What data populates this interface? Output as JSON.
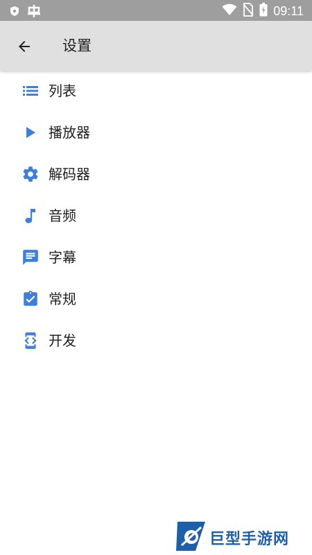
{
  "status_bar": {
    "time": "09:11",
    "icons": [
      "shield-icon",
      "bug-icon",
      "wifi-icon",
      "no-sim-icon",
      "battery-charging-icon"
    ]
  },
  "app_bar": {
    "back_icon": "arrow-back-icon",
    "title": "设置"
  },
  "menu": {
    "items": [
      {
        "label": "列表",
        "icon": "list-icon"
      },
      {
        "label": "播放器",
        "icon": "play-icon"
      },
      {
        "label": "解码器",
        "icon": "gear-icon"
      },
      {
        "label": "音频",
        "icon": "music-note-icon"
      },
      {
        "label": "字幕",
        "icon": "subtitle-chat-icon"
      },
      {
        "label": "常规",
        "icon": "clipboard-check-icon"
      },
      {
        "label": "开发",
        "icon": "developer-mode-icon"
      }
    ]
  },
  "watermark": {
    "text": "巨型手游网"
  },
  "colors": {
    "accent": "#3f7fd8",
    "status_bar": "#9e9e9e",
    "app_bar": "#e0e0e0",
    "text": "#212121"
  }
}
